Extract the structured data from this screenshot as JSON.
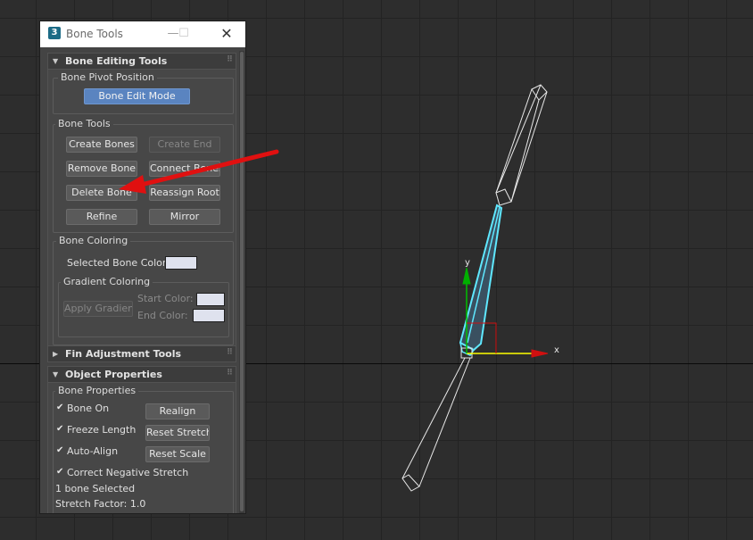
{
  "window": {
    "title": "Bone Tools",
    "app_icon_glyph": "3",
    "minimize_glyph": "—",
    "maximize_glyph": "☐",
    "close_glyph": "✕"
  },
  "bone_editing": {
    "header": "Bone Editing Tools",
    "pivot_group": "Bone Pivot Position",
    "edit_mode_button": "Bone Edit Mode",
    "tools_group": "Bone Tools",
    "create_bones": "Create Bones",
    "create_end": "Create End",
    "remove_bone": "Remove Bone",
    "connect_bones": "Connect Bones",
    "delete_bone": "Delete Bone",
    "reassign_root": "Reassign Root",
    "refine": "Refine",
    "mirror": "Mirror",
    "coloring_group": "Bone Coloring",
    "selected_color_label": "Selected Bone Color:",
    "gradient_group": "Gradient Coloring",
    "apply_gradient": "Apply Gradient",
    "start_color_label": "Start Color:",
    "end_color_label": "End Color:"
  },
  "fin_adjustment": {
    "header": "Fin Adjustment Tools"
  },
  "object_properties": {
    "header": "Object Properties",
    "group": "Bone Properties",
    "bone_on": "Bone On",
    "realign": "Realign",
    "freeze_length": "Freeze Length",
    "reset_stretch": "Reset Stretch",
    "auto_align": "Auto-Align",
    "reset_scale": "Reset Scale",
    "correct_negative_stretch": "Correct Negative Stretch",
    "selection_status": "1 bone Selected",
    "stretch_factor": "Stretch Factor: 1.0",
    "check_glyph": "✔"
  },
  "viewport": {
    "axis_x_label": "x",
    "axis_y_label": "y"
  },
  "colors": {
    "selected_bone": "#5fe8ff",
    "bone_wire": "#e8e8e8",
    "annotation_arrow": "#e01010",
    "gizmo_x": "#ffff00",
    "gizmo_y": "#00c000"
  }
}
